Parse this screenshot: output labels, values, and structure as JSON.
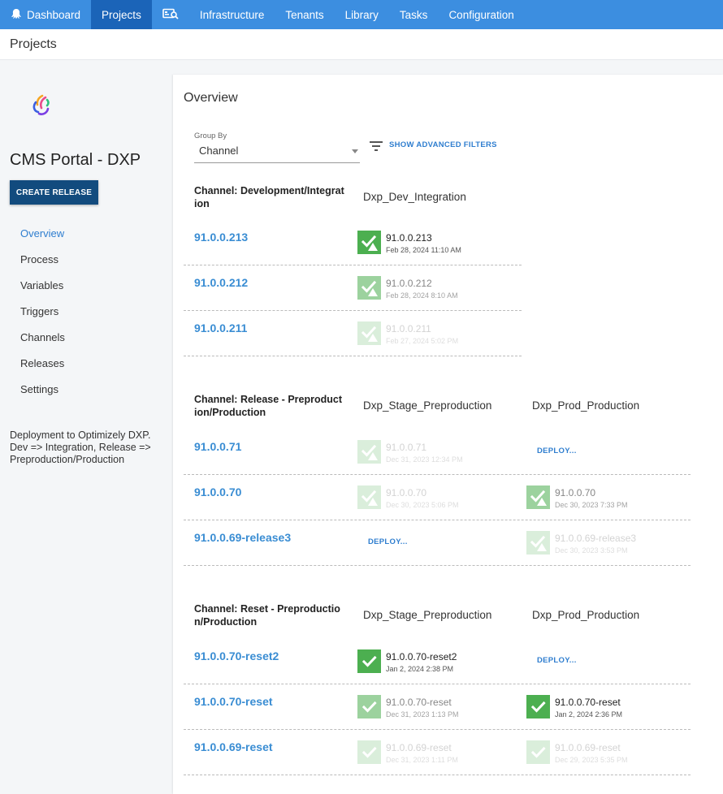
{
  "topnav": {
    "items": [
      {
        "label": "Dashboard",
        "icon": "octopus-icon"
      },
      {
        "label": "Projects",
        "active": true
      },
      {
        "label": "",
        "icon": "search-screen-icon"
      },
      {
        "label": "Infrastructure"
      },
      {
        "label": "Tenants"
      },
      {
        "label": "Library"
      },
      {
        "label": "Tasks"
      },
      {
        "label": "Configuration"
      }
    ]
  },
  "page_title": "Projects",
  "sidebar": {
    "project_name": "CMS Portal - DXP",
    "create_release": "CREATE RELEASE",
    "nav": [
      "Overview",
      "Process",
      "Variables",
      "Triggers",
      "Channels",
      "Releases",
      "Settings"
    ],
    "active_nav": "Overview",
    "description": "Deployment to Optimizely DXP. Dev => Integration, Release => Preproduction/Production"
  },
  "main": {
    "title": "Overview",
    "group_by_label": "Group By",
    "group_by_value": "Channel",
    "advanced_filters": "SHOW ADVANCED FILTERS",
    "channels": [
      {
        "title": "Channel: Development/Integration",
        "environments": [
          "Dxp_Dev_Integration"
        ],
        "releases": [
          {
            "version": "91.0.0.213",
            "deployments": [
              {
                "version": "91.0.0.213",
                "date": "Feb 28, 2024 11:10 AM",
                "state": "current",
                "warning": true
              }
            ]
          },
          {
            "version": "91.0.0.212",
            "deployments": [
              {
                "version": "91.0.0.212",
                "date": "Feb 28, 2024 8:10 AM",
                "state": "previous",
                "warning": true
              }
            ]
          },
          {
            "version": "91.0.0.211",
            "deployments": [
              {
                "version": "91.0.0.211",
                "date": "Feb 27, 2024 5:02 PM",
                "state": "faded",
                "warning": true
              }
            ]
          }
        ]
      },
      {
        "title": "Channel: Release - Preproduction/Production",
        "environments": [
          "Dxp_Stage_Preproduction",
          "Dxp_Prod_Production"
        ],
        "releases": [
          {
            "version": "91.0.0.71",
            "deployments": [
              {
                "version": "91.0.0.71",
                "date": "Dec 31, 2023 12:34 PM",
                "state": "faded",
                "warning": true
              },
              {
                "deploy": "DEPLOY..."
              }
            ]
          },
          {
            "version": "91.0.0.70",
            "deployments": [
              {
                "version": "91.0.0.70",
                "date": "Dec 30, 2023 5:06 PM",
                "state": "faded",
                "warning": true
              },
              {
                "version": "91.0.0.70",
                "date": "Dec 30, 2023 7:33 PM",
                "state": "previous",
                "warning": true
              }
            ]
          },
          {
            "version": "91.0.0.69-release3",
            "deployments": [
              {
                "deploy": "DEPLOY..."
              },
              {
                "version": "91.0.0.69-release3",
                "date": "Dec 30, 2023 3:53 PM",
                "state": "faded",
                "warning": true
              }
            ]
          }
        ]
      },
      {
        "title": "Channel: Reset - Preproduction/Production",
        "environments": [
          "Dxp_Stage_Preproduction",
          "Dxp_Prod_Production"
        ],
        "releases": [
          {
            "version": "91.0.0.70-reset2",
            "deployments": [
              {
                "version": "91.0.0.70-reset2",
                "date": "Jan 2, 2024 2:38 PM",
                "state": "current",
                "warning": false
              },
              {
                "deploy": "DEPLOY..."
              }
            ]
          },
          {
            "version": "91.0.0.70-reset",
            "deployments": [
              {
                "version": "91.0.0.70-reset",
                "date": "Dec 31, 2023 1:13 PM",
                "state": "previous",
                "warning": false
              },
              {
                "version": "91.0.0.70-reset",
                "date": "Jan 2, 2024 2:36 PM",
                "state": "current",
                "warning": false
              }
            ]
          },
          {
            "version": "91.0.0.69-reset",
            "deployments": [
              {
                "version": "91.0.0.69-reset",
                "date": "Dec 31, 2023 1:11 PM",
                "state": "faded",
                "warning": false
              },
              {
                "version": "91.0.0.69-reset",
                "date": "Dec 29, 2023 5:35 PM",
                "state": "faded",
                "warning": false
              }
            ]
          }
        ]
      }
    ]
  },
  "colors": {
    "nav_bg": "#3c8ee0",
    "nav_active": "#1b64b8",
    "success": "#4caf50",
    "link": "#3a8dd3",
    "button": "#124b7e"
  }
}
